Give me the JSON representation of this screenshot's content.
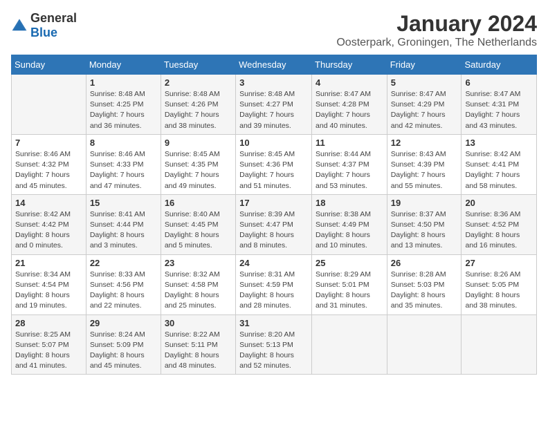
{
  "logo": {
    "general": "General",
    "blue": "Blue"
  },
  "title": "January 2024",
  "location": "Oosterpark, Groningen, The Netherlands",
  "days_of_week": [
    "Sunday",
    "Monday",
    "Tuesday",
    "Wednesday",
    "Thursday",
    "Friday",
    "Saturday"
  ],
  "weeks": [
    [
      {
        "day": "",
        "info": ""
      },
      {
        "day": "1",
        "info": "Sunrise: 8:48 AM\nSunset: 4:25 PM\nDaylight: 7 hours\nand 36 minutes."
      },
      {
        "day": "2",
        "info": "Sunrise: 8:48 AM\nSunset: 4:26 PM\nDaylight: 7 hours\nand 38 minutes."
      },
      {
        "day": "3",
        "info": "Sunrise: 8:48 AM\nSunset: 4:27 PM\nDaylight: 7 hours\nand 39 minutes."
      },
      {
        "day": "4",
        "info": "Sunrise: 8:47 AM\nSunset: 4:28 PM\nDaylight: 7 hours\nand 40 minutes."
      },
      {
        "day": "5",
        "info": "Sunrise: 8:47 AM\nSunset: 4:29 PM\nDaylight: 7 hours\nand 42 minutes."
      },
      {
        "day": "6",
        "info": "Sunrise: 8:47 AM\nSunset: 4:31 PM\nDaylight: 7 hours\nand 43 minutes."
      }
    ],
    [
      {
        "day": "7",
        "info": "Sunrise: 8:46 AM\nSunset: 4:32 PM\nDaylight: 7 hours\nand 45 minutes."
      },
      {
        "day": "8",
        "info": "Sunrise: 8:46 AM\nSunset: 4:33 PM\nDaylight: 7 hours\nand 47 minutes."
      },
      {
        "day": "9",
        "info": "Sunrise: 8:45 AM\nSunset: 4:35 PM\nDaylight: 7 hours\nand 49 minutes."
      },
      {
        "day": "10",
        "info": "Sunrise: 8:45 AM\nSunset: 4:36 PM\nDaylight: 7 hours\nand 51 minutes."
      },
      {
        "day": "11",
        "info": "Sunrise: 8:44 AM\nSunset: 4:37 PM\nDaylight: 7 hours\nand 53 minutes."
      },
      {
        "day": "12",
        "info": "Sunrise: 8:43 AM\nSunset: 4:39 PM\nDaylight: 7 hours\nand 55 minutes."
      },
      {
        "day": "13",
        "info": "Sunrise: 8:42 AM\nSunset: 4:41 PM\nDaylight: 7 hours\nand 58 minutes."
      }
    ],
    [
      {
        "day": "14",
        "info": "Sunrise: 8:42 AM\nSunset: 4:42 PM\nDaylight: 8 hours\nand 0 minutes."
      },
      {
        "day": "15",
        "info": "Sunrise: 8:41 AM\nSunset: 4:44 PM\nDaylight: 8 hours\nand 3 minutes."
      },
      {
        "day": "16",
        "info": "Sunrise: 8:40 AM\nSunset: 4:45 PM\nDaylight: 8 hours\nand 5 minutes."
      },
      {
        "day": "17",
        "info": "Sunrise: 8:39 AM\nSunset: 4:47 PM\nDaylight: 8 hours\nand 8 minutes."
      },
      {
        "day": "18",
        "info": "Sunrise: 8:38 AM\nSunset: 4:49 PM\nDaylight: 8 hours\nand 10 minutes."
      },
      {
        "day": "19",
        "info": "Sunrise: 8:37 AM\nSunset: 4:50 PM\nDaylight: 8 hours\nand 13 minutes."
      },
      {
        "day": "20",
        "info": "Sunrise: 8:36 AM\nSunset: 4:52 PM\nDaylight: 8 hours\nand 16 minutes."
      }
    ],
    [
      {
        "day": "21",
        "info": "Sunrise: 8:34 AM\nSunset: 4:54 PM\nDaylight: 8 hours\nand 19 minutes."
      },
      {
        "day": "22",
        "info": "Sunrise: 8:33 AM\nSunset: 4:56 PM\nDaylight: 8 hours\nand 22 minutes."
      },
      {
        "day": "23",
        "info": "Sunrise: 8:32 AM\nSunset: 4:58 PM\nDaylight: 8 hours\nand 25 minutes."
      },
      {
        "day": "24",
        "info": "Sunrise: 8:31 AM\nSunset: 4:59 PM\nDaylight: 8 hours\nand 28 minutes."
      },
      {
        "day": "25",
        "info": "Sunrise: 8:29 AM\nSunset: 5:01 PM\nDaylight: 8 hours\nand 31 minutes."
      },
      {
        "day": "26",
        "info": "Sunrise: 8:28 AM\nSunset: 5:03 PM\nDaylight: 8 hours\nand 35 minutes."
      },
      {
        "day": "27",
        "info": "Sunrise: 8:26 AM\nSunset: 5:05 PM\nDaylight: 8 hours\nand 38 minutes."
      }
    ],
    [
      {
        "day": "28",
        "info": "Sunrise: 8:25 AM\nSunset: 5:07 PM\nDaylight: 8 hours\nand 41 minutes."
      },
      {
        "day": "29",
        "info": "Sunrise: 8:24 AM\nSunset: 5:09 PM\nDaylight: 8 hours\nand 45 minutes."
      },
      {
        "day": "30",
        "info": "Sunrise: 8:22 AM\nSunset: 5:11 PM\nDaylight: 8 hours\nand 48 minutes."
      },
      {
        "day": "31",
        "info": "Sunrise: 8:20 AM\nSunset: 5:13 PM\nDaylight: 8 hours\nand 52 minutes."
      },
      {
        "day": "",
        "info": ""
      },
      {
        "day": "",
        "info": ""
      },
      {
        "day": "",
        "info": ""
      }
    ]
  ]
}
